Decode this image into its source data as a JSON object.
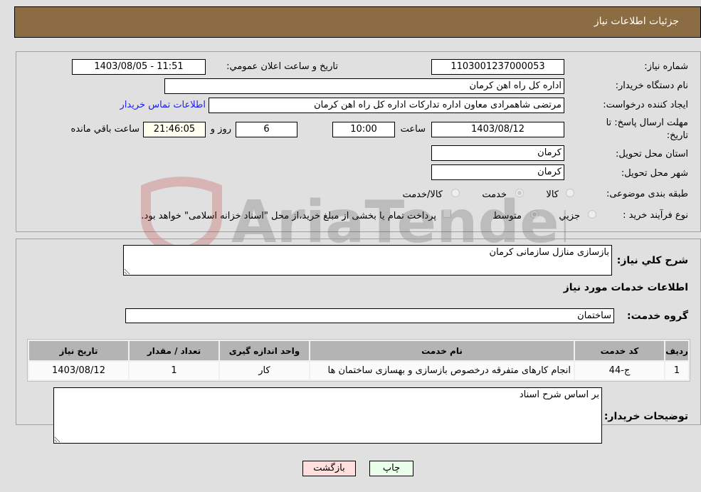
{
  "header": {
    "title": "جزئیات اطلاعات نیاز"
  },
  "form": {
    "need_number": {
      "label": "شماره نیاز:",
      "value": "1103001237000053"
    },
    "announce_datetime": {
      "label": "تاریخ و ساعت اعلان عمومي:",
      "value": "1403/08/05 - 11:51"
    },
    "buyer_org": {
      "label": "نام دستگاه خریدار:",
      "value": "اداره کل راه اهن کرمان"
    },
    "requester": {
      "label": "ایجاد کننده درخواست:",
      "value": "مرتضی  شاهمرادی  معاون اداره تدارکات  اداره کل راه اهن کرمان",
      "contact_link": "اطلاعات تماس خریدار"
    },
    "deadline": {
      "label_line1": "مهلت ارسال پاسخ: تا",
      "label_line2": "تاریخ:",
      "date": "1403/08/12",
      "time_label": "ساعت",
      "time": "10:00",
      "days": "6",
      "days_label": "روز و",
      "remaining": "21:46:05",
      "remaining_label": "ساعت باقي مانده"
    },
    "province": {
      "label": "استان محل تحویل:",
      "value": "کرمان"
    },
    "city": {
      "label": "شهر محل تحویل:",
      "value": "کرمان"
    },
    "category": {
      "label": "طبقه بندی موضوعی:",
      "options": [
        "کالا",
        "خدمت",
        "کالا/خدمت"
      ],
      "selected": "خدمت"
    },
    "purchase_type": {
      "label": "نوع فرآیند خرید :",
      "options": [
        "جزيي",
        "متوسط"
      ],
      "selected": "متوسط",
      "treasury_note": "پرداخت تمام یا بخشی از مبلغ خرید،از محل \"اسناد خزانه اسلامی\" خواهد بود."
    }
  },
  "details": {
    "general_desc_label": "شرح کلي نیاز:",
    "general_desc": "بازسازی منازل سازمانی کرمان",
    "services_title": "اطلاعات خدمات مورد نیاز",
    "service_group_label": "گروه خدمت:",
    "service_group": "ساختمان",
    "table": {
      "headers": [
        "ردیف",
        "کد خدمت",
        "نام خدمت",
        "واحد اندازه گیری",
        "تعداد / مقدار",
        "تاریخ نیاز"
      ],
      "rows": [
        [
          "1",
          "ج-44",
          "انجام کارهای متفرقه درخصوص بازسازی و بهسازی ساختمان ها",
          "کار",
          "1",
          "1403/08/12"
        ]
      ]
    },
    "buyer_notes_label": "توضیحات خریدار:",
    "buyer_notes": "بر اساس شرح اسناد"
  },
  "buttons": {
    "print": "چاپ",
    "back": "بازگشت"
  },
  "watermark": "AriaTender.neT",
  "colors": {
    "header_bg": "#8c6c43",
    "print_bg": "#eaffea",
    "back_bg": "#ffdede",
    "link": "#1a1aff"
  }
}
